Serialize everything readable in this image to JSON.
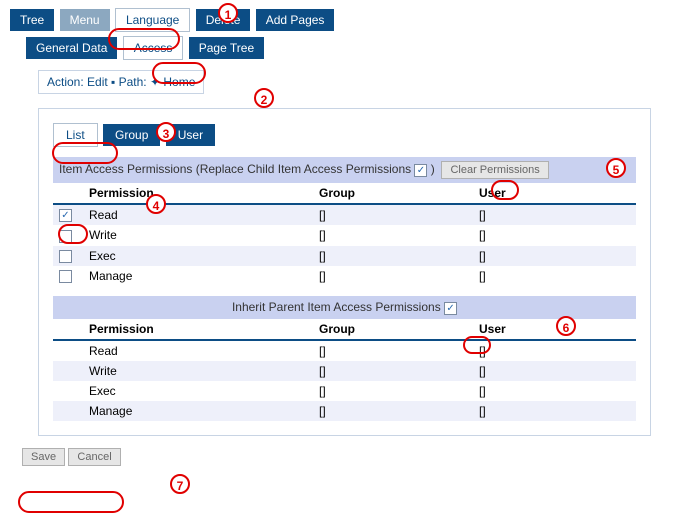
{
  "tabs_row1": [
    "Tree",
    "Menu",
    "Language",
    "Delete",
    "Add Pages"
  ],
  "tabs_row1_active": "Menu",
  "tabs_row2": [
    "General Data",
    "Access",
    "Page Tree"
  ],
  "tabs_row2_white": "Access",
  "breadcrumb": "Action: Edit ▪ Path: ✦ Home",
  "subtabs": [
    "List",
    "Group",
    "User"
  ],
  "subtabs_selected": "Group",
  "section1_title": "Item Access Permissions (Replace Child Item Access Permissions",
  "clear_btn": "Clear Permissions",
  "col_permission": "Permission",
  "col_group": "Group",
  "col_user": "User",
  "rows1": [
    {
      "checked": true,
      "perm": "Read",
      "group": "[]",
      "user": "[]"
    },
    {
      "checked": false,
      "perm": "Write",
      "group": "[]",
      "user": "[]"
    },
    {
      "checked": false,
      "perm": "Exec",
      "group": "[]",
      "user": "[]"
    },
    {
      "checked": false,
      "perm": "Manage",
      "group": "[]",
      "user": "[]"
    }
  ],
  "section2_title": "Inherit Parent Item Access Permissions",
  "rows2": [
    {
      "perm": "Read",
      "group": "[]",
      "user": "[]"
    },
    {
      "perm": "Write",
      "group": "[]",
      "user": "[]"
    },
    {
      "perm": "Exec",
      "group": "[]",
      "user": "[]"
    },
    {
      "perm": "Manage",
      "group": "[]",
      "user": "[]"
    }
  ],
  "save": "Save",
  "cancel": "Cancel",
  "checkmark": "✓",
  "annotations": [
    "1",
    "2",
    "3",
    "4",
    "5",
    "6",
    "7"
  ]
}
